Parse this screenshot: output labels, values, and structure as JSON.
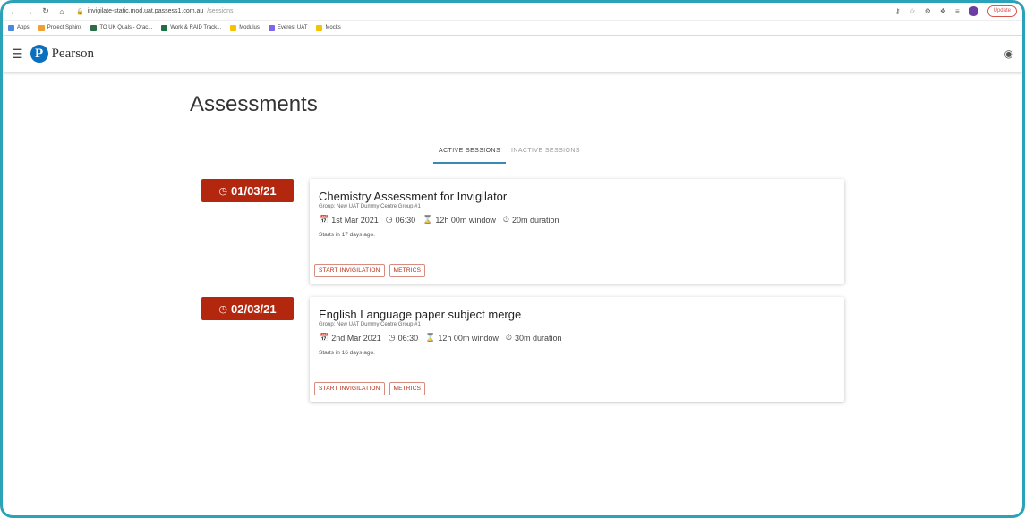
{
  "browser": {
    "url_host": "invigilate-static.mod.uat.passess1.com.au",
    "url_path": "/sessions",
    "update_label": "Update",
    "profile_initial": "L",
    "bookmarks": [
      {
        "label": "Apps",
        "color": "#4a89dc"
      },
      {
        "label": "Project Sphinx",
        "color": "#f0a030"
      },
      {
        "label": "TO UK Quals - Orac...",
        "color": "#2c6e49"
      },
      {
        "label": "Work & RAID Track...",
        "color": "#1e7145"
      },
      {
        "label": "Modulus",
        "color": "#f5c400"
      },
      {
        "label": "Everest UAT",
        "color": "#7b68ee"
      },
      {
        "label": "Mocks",
        "color": "#f5c400"
      }
    ]
  },
  "header": {
    "logo_letter": "P",
    "brand": "Pearson"
  },
  "page": {
    "title": "Assessments",
    "tabs": [
      {
        "label": "ACTIVE SESSIONS",
        "active": true
      },
      {
        "label": "INACTIVE SESSIONS",
        "active": false
      }
    ]
  },
  "sessions": [
    {
      "date_badge": "01/03/21",
      "title": "Chemistry Assessment for Invigilator",
      "group": "Group: New UAT Dummy Centre Group #1",
      "date": "1st Mar 2021",
      "time": "06:30",
      "window": "12h 00m window",
      "duration": "20m duration",
      "starts": "Starts in 17 days ago.",
      "start_label": "START INVIGILATION",
      "metrics_label": "METRICS"
    },
    {
      "date_badge": "02/03/21",
      "title": "English Language paper subject merge",
      "group": "Group: New UAT Dummy Centre Group #1",
      "date": "2nd Mar 2021",
      "time": "06:30",
      "window": "12h 00m window",
      "duration": "30m duration",
      "starts": "Starts in 16 days ago.",
      "start_label": "START INVIGILATION",
      "metrics_label": "METRICS"
    }
  ],
  "colors": {
    "badge": "#b3270f",
    "accent_tab": "#3a89b0",
    "frame": "#2aa3b8",
    "logo": "#0b6fbd"
  }
}
